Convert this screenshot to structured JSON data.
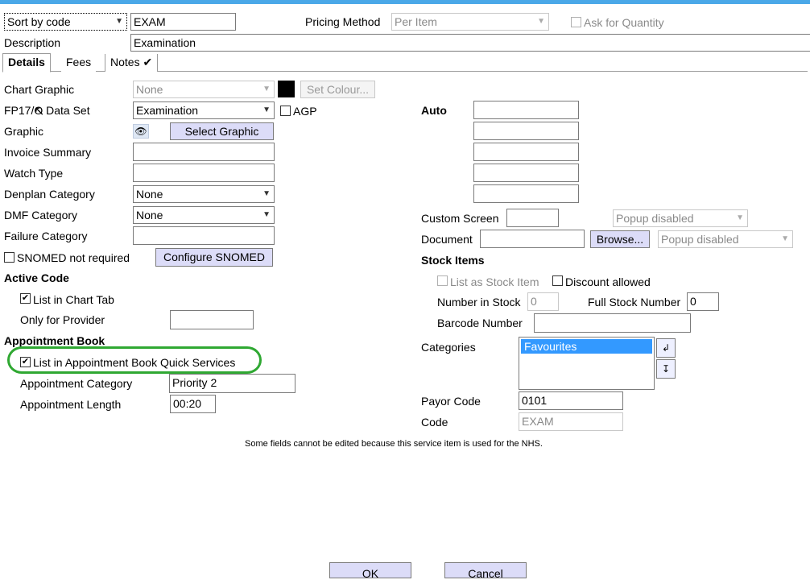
{
  "header": {
    "sort_select": "Sort by code",
    "code_value": "EXAM",
    "pricing_label": "Pricing Method",
    "pricing_value": "Per Item",
    "ask_quantity_label": "Ask for Quantity",
    "description_label": "Description",
    "description_value": "Examination"
  },
  "tabs": [
    {
      "label": "Details"
    },
    {
      "label": "Fees"
    },
    {
      "label": "Notes ✔"
    }
  ],
  "left": {
    "chart_graphic_label": "Chart Graphic",
    "chart_graphic_value": "None",
    "set_colour_button": "Set Colour...",
    "fp17_label": "FP17/O Data Set",
    "fp17_value": "Examination",
    "agp_label": "AGP",
    "graphic_label": "Graphic",
    "select_graphic_button": "Select Graphic",
    "invoice_summary_label": "Invoice Summary",
    "watch_type_label": "Watch Type",
    "denplan_label": "Denplan Category",
    "denplan_value": "None",
    "dmf_label": "DMF Category",
    "dmf_value": "None",
    "failure_label": "Failure Category",
    "snomed_label": "SNOMED not required",
    "configure_snomed_button": "Configure SNOMED",
    "active_code_heading": "Active Code",
    "list_chart_tab_label": "List in Chart Tab",
    "only_provider_label": "Only for Provider",
    "appointment_book_heading": "Appointment Book",
    "quick_services_label": "List in Appointment Book Quick Services",
    "appt_category_label": "Appointment Category",
    "appt_category_value": "Priority 2",
    "appt_length_label": "Appointment Length",
    "appt_length_value": "00:20"
  },
  "right": {
    "auto_label": "Auto",
    "custom_screen_label": "Custom Screen",
    "popup_disabled_1": "Popup disabled",
    "document_label": "Document",
    "browse_button": "Browse...",
    "popup_disabled_2": "Popup disabled",
    "stock_items_heading": "Stock Items",
    "list_stock_label": "List as Stock Item",
    "discount_label": "Discount allowed",
    "number_stock_label": "Number in Stock",
    "number_stock_value": "0",
    "full_stock_label": "Full Stock Number",
    "full_stock_value": "0",
    "barcode_label": "Barcode Number",
    "categories_label": "Categories",
    "categories_items": [
      "Favourites"
    ],
    "payor_code_label": "Payor Code",
    "payor_code_value": "0101",
    "code_label": "Code",
    "code_value": "EXAM"
  },
  "notice": "Some fields cannot be edited because this service item is used for the NHS.",
  "footer": {
    "ok_button": "OK",
    "cancel_button": "Cancel"
  },
  "colors": {
    "accent_bar": "#4aa8e8",
    "button_bg": "#dcdcf8",
    "selection": "#3399ff",
    "highlight_ellipse": "#2fa832",
    "colour_swatch": "#000000"
  }
}
